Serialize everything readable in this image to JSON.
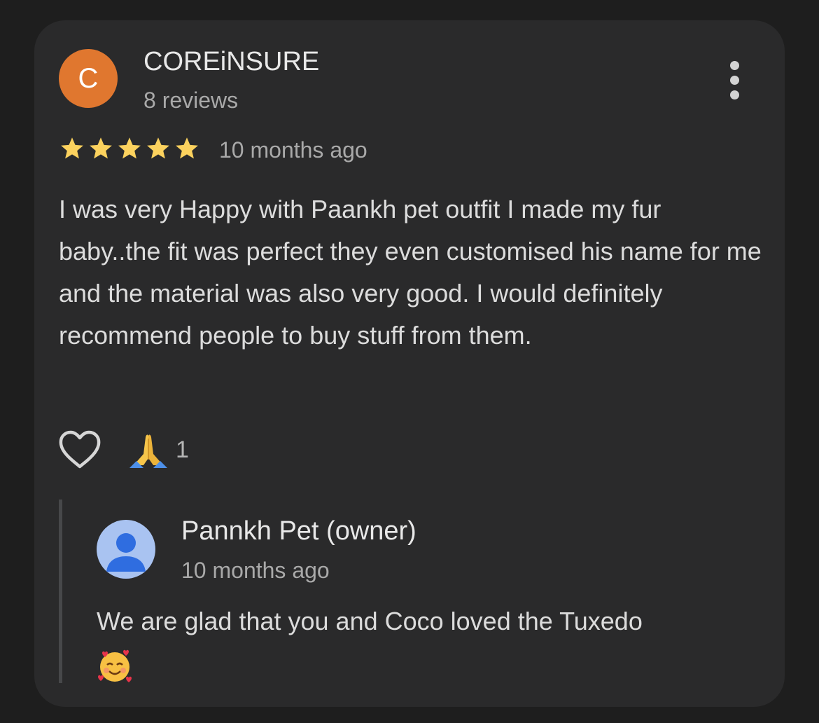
{
  "review": {
    "author": {
      "initial": "C",
      "name": "COREiNSURE",
      "review_count": "8 reviews",
      "avatar_color": "#e0772f"
    },
    "rating": 5,
    "rating_max": 5,
    "star_color": "#fcd25e",
    "time": "10 months ago",
    "text": "I was very Happy with Paankh pet outfit I made my fur baby..the fit was perfect they even customised his name for me and the material was also very good. I would definitely recommend people to buy stuff from them.",
    "reactions": {
      "like_icon": "heart-outline-icon",
      "reaction_icon": "folded-hands-emoji",
      "reaction_count": "1"
    },
    "menu_icon": "more-vertical-icon"
  },
  "owner_reply": {
    "name": "Pannkh Pet (owner)",
    "avatar_icon": "person-icon",
    "avatar_color": "#a9c3f1",
    "time": "10 months ago",
    "text": "We are glad that you and Coco loved the Tuxedo",
    "emoji_icon": "smiling-face-with-hearts-emoji"
  }
}
